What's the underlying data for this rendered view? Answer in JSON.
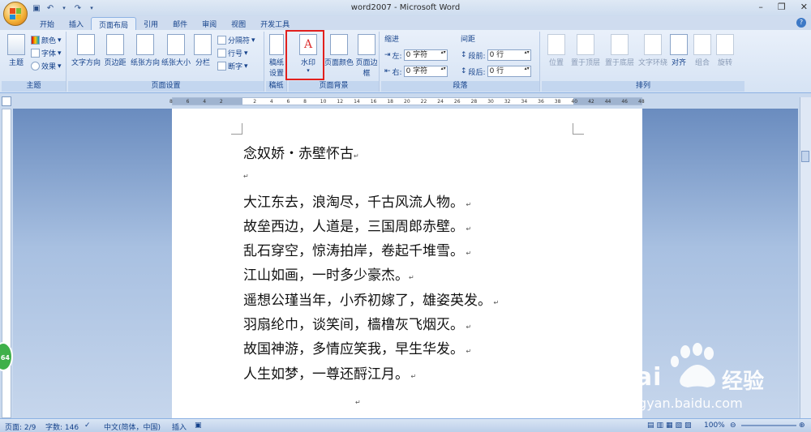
{
  "window": {
    "title": "word2007 - Microsoft Word"
  },
  "qat": {
    "save_icon": "save-icon",
    "undo_icon": "undo-icon",
    "redo_icon": "redo-icon"
  },
  "tabs": [
    {
      "label": "开始"
    },
    {
      "label": "插入"
    },
    {
      "label": "页面布局"
    },
    {
      "label": "引用"
    },
    {
      "label": "邮件"
    },
    {
      "label": "审阅"
    },
    {
      "label": "视图"
    },
    {
      "label": "开发工具"
    }
  ],
  "ribbon": {
    "themes": {
      "group": "主题",
      "theme": "主题",
      "colors": "颜色",
      "fonts": "字体",
      "effects": "效果"
    },
    "page_setup": {
      "group": "页面设置",
      "text_direction": "文字方向",
      "margins": "页边距",
      "orientation": "纸张方向",
      "size": "纸张大小",
      "columns": "分栏",
      "breaks": "分隔符",
      "line_numbers": "行号",
      "hyphenation": "断字"
    },
    "draft": {
      "group": "稿纸",
      "draft_settings": "稿纸设置"
    },
    "page_background": {
      "group": "页面背景",
      "watermark": "水印",
      "page_color": "页面颜色",
      "page_borders": "页面边框"
    },
    "paragraph": {
      "group": "段落",
      "indent": "缩进",
      "spacing": "间距",
      "left_label": "左:",
      "left_value": "0 字符",
      "right_label": "右:",
      "right_value": "0 字符",
      "before_label": "段前:",
      "before_value": "0 行",
      "after_label": "段后:",
      "after_value": "0 行"
    },
    "arrange": {
      "group": "排列",
      "position": "位置",
      "bring_front": "置于顶层",
      "send_back": "置于底层",
      "wrap": "文字环绕",
      "align": "对齐",
      "group_btn": "组合",
      "rotate": "旋转"
    }
  },
  "ruler": {
    "ticks": [
      "8",
      "6",
      "4",
      "2",
      "",
      "2",
      "4",
      "6",
      "8",
      "10",
      "12",
      "14",
      "16",
      "18",
      "20",
      "22",
      "24",
      "26",
      "28",
      "30",
      "32",
      "34",
      "36",
      "38",
      "40",
      "42",
      "44",
      "46",
      "48"
    ]
  },
  "document": {
    "title": "念奴娇・赤壁怀古",
    "lines": [
      "大江东去，浪淘尽，千古风流人物。",
      "故垒西边，人道是，三国周郎赤壁。",
      "乱石穿空，惊涛拍岸，卷起千堆雪。",
      "江山如画，一时多少豪杰。",
      "遥想公瑾当年，小乔初嫁了，雄姿英发。",
      "羽扇纶巾，谈笑间，樯橹灰飞烟灭。",
      "故国神游，多情应笑我，早生华发。",
      "人生如梦，一尊还酹江月。"
    ]
  },
  "status": {
    "page": "页面: 2/9",
    "words": "字数: 146",
    "language": "中文(简体，中国)",
    "mode": "插入",
    "zoom": "100%"
  },
  "watermark": {
    "brand": "Bai",
    "brand2": "经验",
    "url": "jingyan.baidu.com"
  },
  "badge": {
    "text": "64"
  }
}
